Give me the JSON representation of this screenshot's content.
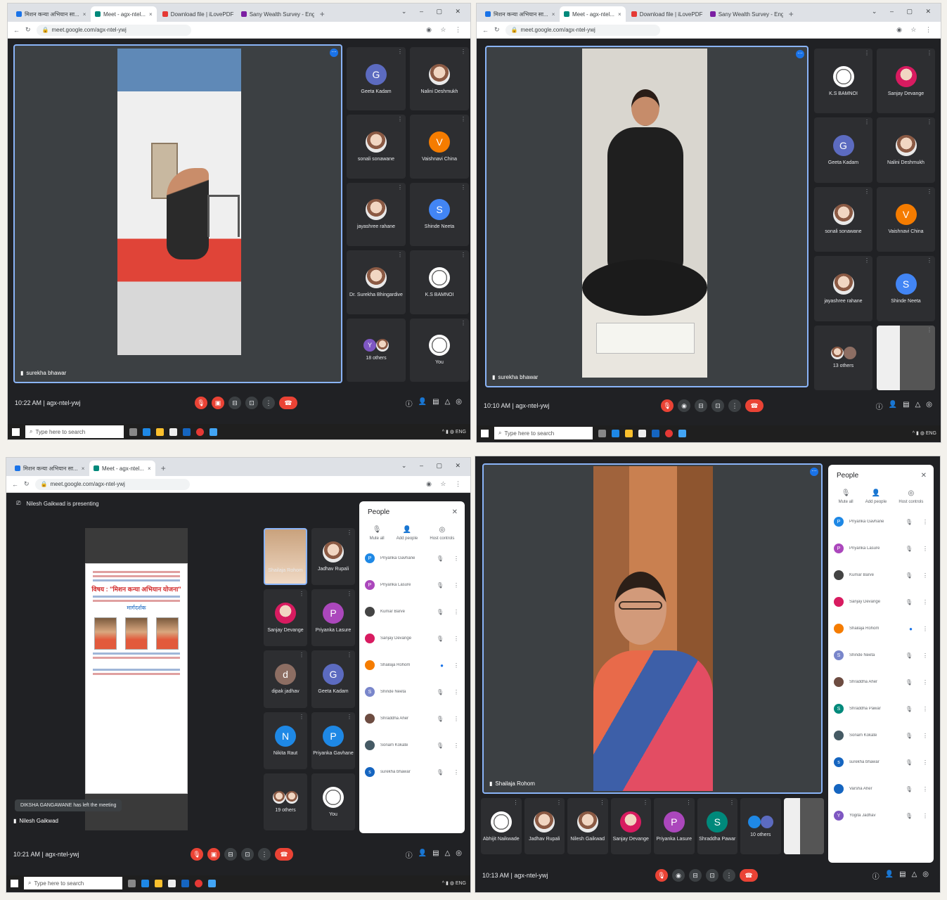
{
  "q1": {
    "tabs": [
      {
        "label": "मिशन कन्या अभियान सा..."
      },
      {
        "label": "Meet - agx-ntel..."
      },
      {
        "label": "Download file | iLovePDF"
      },
      {
        "label": "Sany Wealth Survey - English"
      }
    ],
    "url": "meet.google.com/agx-ntel-ywj",
    "main_speaker": "surekha bhawar",
    "participants": [
      {
        "name": "Geeta Kadam",
        "initial": "G",
        "color": "#5c6bc0"
      },
      {
        "name": "Nalini Deshmukh",
        "initial": "",
        "color": "photo"
      },
      {
        "name": "sonali sonawane",
        "initial": "",
        "color": "photo"
      },
      {
        "name": "Vaishnavi China",
        "initial": "V",
        "color": "#f57c00"
      },
      {
        "name": "jayashree rahane",
        "initial": "",
        "color": "photo"
      },
      {
        "name": "Shinde Neeta",
        "initial": "S",
        "color": "#4285f4"
      },
      {
        "name": "Dr. Surekha Bhingardive",
        "initial": "",
        "color": "photo"
      },
      {
        "name": "K.S BAMNOI",
        "initial": "",
        "color": "seal"
      },
      {
        "name": "18 others",
        "initial": "Y",
        "color": "#7e57c2"
      },
      {
        "name": "You",
        "initial": "",
        "color": "seal"
      }
    ],
    "time": "10:22 AM",
    "meeting_code": "agx-ntel-ywj",
    "search_placeholder": "Type here to search"
  },
  "q2": {
    "url": "meet.google.com/agx-ntel-ywj",
    "main_speaker": "surekha bhawar",
    "participants": [
      {
        "name": "K.S BAMNOI",
        "initial": "",
        "color": "seal"
      },
      {
        "name": "Sanjay Devange",
        "initial": "",
        "color": "photo"
      },
      {
        "name": "Geeta Kadam",
        "initial": "G",
        "color": "#5c6bc0"
      },
      {
        "name": "Nalini Deshmukh",
        "initial": "",
        "color": "photo"
      },
      {
        "name": "sonali sonawane",
        "initial": "",
        "color": "photo"
      },
      {
        "name": "Vaishnavi China",
        "initial": "V",
        "color": "#f57c00"
      },
      {
        "name": "jayashree rahane",
        "initial": "",
        "color": "photo"
      },
      {
        "name": "Shinde Neeta",
        "initial": "S",
        "color": "#4285f4"
      },
      {
        "name": "13 others",
        "initial": "",
        "color": "photo"
      },
      {
        "name": "",
        "initial": "",
        "color": "video"
      }
    ],
    "time": "10:10 AM",
    "meeting_code": "agx-ntel-ywj",
    "search_placeholder": "Type here to search"
  },
  "q3": {
    "url": "meet.google.com/agx-ntel-ywj",
    "presenting": "Nilesh Gaikwad is presenting",
    "poster_title": "विषय : \"मिशन कन्या अभियान योजना\"",
    "poster_heading": "मार्गदर्शक",
    "tiles": [
      {
        "name": "Shailaja Rohom",
        "initial": "",
        "color": "video"
      },
      {
        "name": "Jadhav Rupali",
        "initial": "",
        "color": "photo"
      },
      {
        "name": "Sanjay Devange",
        "initial": "",
        "color": "photo"
      },
      {
        "name": "Priyanka Lasure",
        "initial": "P",
        "color": "#ab47bc"
      },
      {
        "name": "dipak jadhav",
        "initial": "d",
        "color": "#8d6e63"
      },
      {
        "name": "Geeta Kadam",
        "initial": "G",
        "color": "#5c6bc0"
      },
      {
        "name": "Nikita Raut",
        "initial": "N",
        "color": "#1e88e5"
      },
      {
        "name": "Priyanka Gavhane",
        "initial": "P",
        "color": "#1e88e5"
      },
      {
        "name": "19 others",
        "initial": "",
        "color": "photo"
      },
      {
        "name": "You",
        "initial": "",
        "color": "seal"
      }
    ],
    "people_panel": {
      "title": "People",
      "mute_all": "Mute all",
      "add_people": "Add people",
      "host_controls": "Host controls",
      "rows": [
        {
          "name": "Priyanka Gavhane",
          "initial": "P",
          "color": "#1e88e5"
        },
        {
          "name": "Priyanka Lasure",
          "initial": "P",
          "color": "#ab47bc"
        },
        {
          "name": "Kumar Barve",
          "initial": "",
          "color": "#444"
        },
        {
          "name": "Sanjay Devange",
          "initial": "",
          "color": "#d81b60"
        },
        {
          "name": "Shailaja Rohom",
          "initial": "",
          "color": "#f57c00"
        },
        {
          "name": "Shinde Neeta",
          "initial": "S",
          "color": "#7986cb"
        },
        {
          "name": "Shraddha Aher",
          "initial": "",
          "color": "#6d4c41"
        },
        {
          "name": "Sonam Kokate",
          "initial": "",
          "color": "#455a64"
        },
        {
          "name": "surekha bhawar",
          "initial": "s",
          "color": "#1565c0"
        }
      ]
    },
    "toast": "DIKSHA GANGAWANE has left the meeting",
    "self_label": "Nilesh Gaikwad",
    "time": "10:21 AM",
    "meeting_code": "agx-ntel-ywj",
    "search_placeholder": "Type here to search"
  },
  "q4": {
    "main_speaker": "Shailaja Rohom",
    "tiles": [
      {
        "name": "Abhijit Naikwade",
        "initial": "",
        "color": "seal"
      },
      {
        "name": "Jadhav Rupali",
        "initial": "",
        "color": "photo"
      },
      {
        "name": "Nilesh Gaikwad",
        "initial": "",
        "color": "photo"
      },
      {
        "name": "Sanjay Devange",
        "initial": "",
        "color": "photo"
      },
      {
        "name": "Priyanka Lasure",
        "initial": "P",
        "color": "#ab47bc"
      },
      {
        "name": "Shraddha Pawar",
        "initial": "S",
        "color": "#00897b"
      },
      {
        "name": "10 others",
        "initial": "",
        "color": "#1e88e5"
      }
    ],
    "people_panel": {
      "title": "People",
      "mute_all": "Mute all",
      "add_people": "Add people",
      "host_controls": "Host controls",
      "rows": [
        {
          "name": "Priyanka Gavhane",
          "initial": "P",
          "color": "#1e88e5"
        },
        {
          "name": "Priyanka Lasure",
          "initial": "P",
          "color": "#ab47bc"
        },
        {
          "name": "Kumar Barve",
          "initial": "",
          "color": "#444"
        },
        {
          "name": "Sanjay Devange",
          "initial": "",
          "color": "#d81b60"
        },
        {
          "name": "Shailaja Rohom",
          "initial": "",
          "color": "#f57c00"
        },
        {
          "name": "Shinde Neeta",
          "initial": "S",
          "color": "#7986cb"
        },
        {
          "name": "Shraddha Aher",
          "initial": "",
          "color": "#6d4c41"
        },
        {
          "name": "Shraddha Pawar",
          "initial": "S",
          "color": "#00897b"
        },
        {
          "name": "Sonam Kokate",
          "initial": "",
          "color": "#455a64"
        },
        {
          "name": "surekha bhawar",
          "initial": "s",
          "color": "#1565c0"
        },
        {
          "name": "Varsha Aher",
          "initial": "",
          "color": "#1565c0"
        },
        {
          "name": "Yogita Jadhav",
          "initial": "Y",
          "color": "#7e57c2"
        }
      ]
    },
    "time": "10:13 AM",
    "meeting_code": "agx-ntel-ywj"
  }
}
